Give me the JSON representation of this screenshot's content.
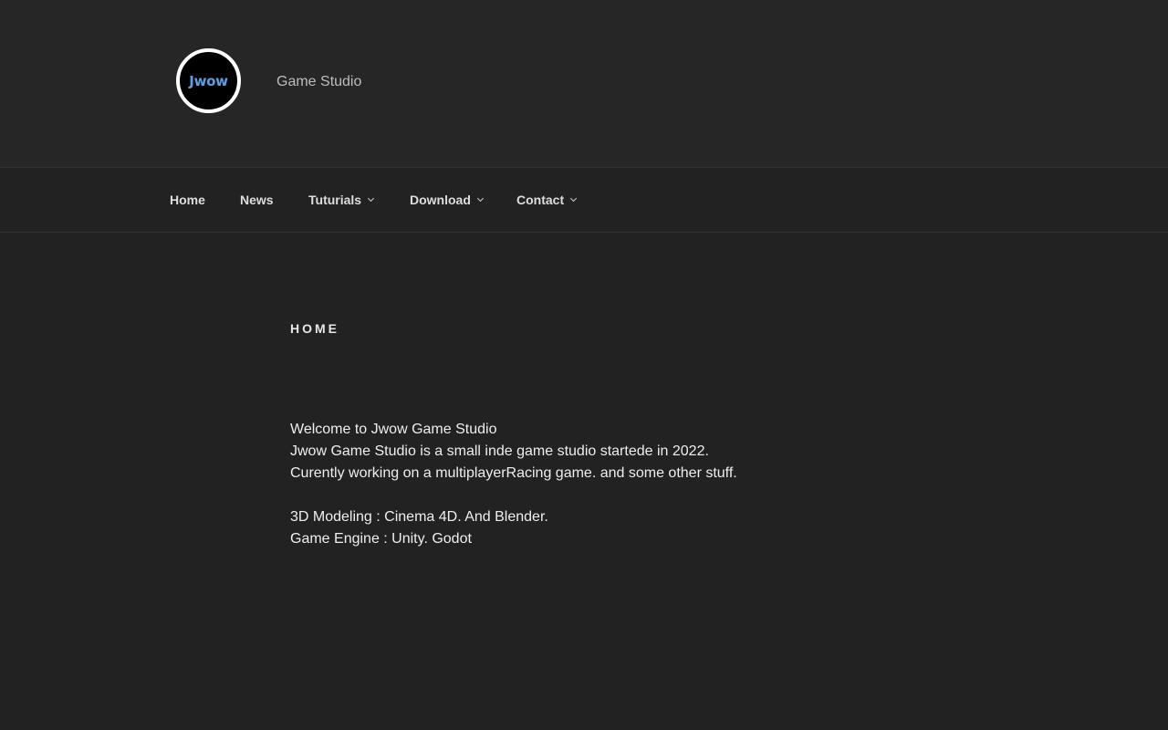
{
  "header": {
    "logo_text": "Jwow",
    "tagline": "Game Studio"
  },
  "nav": {
    "items": [
      {
        "label": "Home",
        "has_dropdown": false
      },
      {
        "label": "News",
        "has_dropdown": false
      },
      {
        "label": "Tuturials",
        "has_dropdown": true
      },
      {
        "label": "Download",
        "has_dropdown": true
      },
      {
        "label": "Contact",
        "has_dropdown": true
      }
    ]
  },
  "page": {
    "title": "HOME",
    "paragraph1": [
      "Welcome to Jwow Game Studio",
      "Jwow Game Studio is a small inde game studio startede in 2022.",
      "Curently working on a multiplayerRacing game. and some other stuff."
    ],
    "paragraph2": [
      "3D Modeling : Cinema 4D. And Blender.",
      "Game Engine : Unity. Godot"
    ]
  },
  "colors": {
    "background": "#222222",
    "header_background": "#262626",
    "logo_text": "#5aa0e8"
  }
}
